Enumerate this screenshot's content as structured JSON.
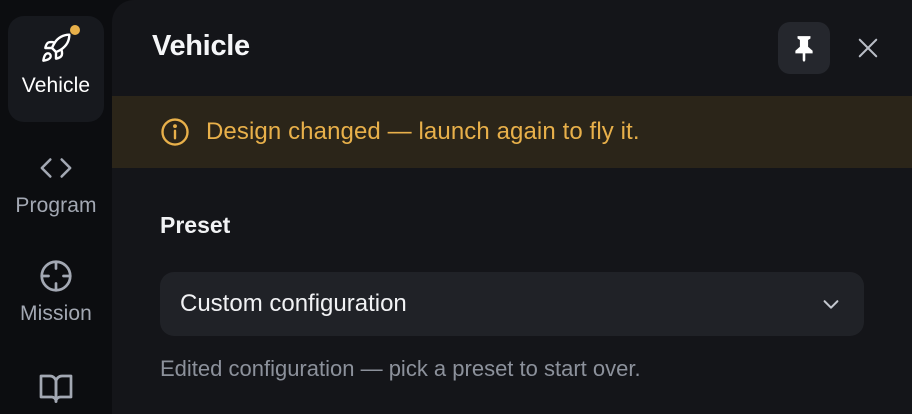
{
  "rail": {
    "items": [
      {
        "label": "Vehicle",
        "icon": "rocket-icon",
        "active": true,
        "badge": true
      },
      {
        "label": "Program",
        "icon": "code-icon",
        "active": false
      },
      {
        "label": "Mission",
        "icon": "crosshair-icon",
        "active": false
      },
      {
        "label": "",
        "icon": "book-icon",
        "active": false
      }
    ]
  },
  "panel": {
    "title": "Vehicle",
    "notice": "Design changed — launch again to fly it.",
    "preset_label": "Preset",
    "preset_value": "Custom configuration",
    "hint": "Edited configuration — pick a preset to start over."
  },
  "colors": {
    "accent_warning": "#e8b04a",
    "panel_bg": "#141519",
    "rail_bg": "#0c0d10",
    "notice_bg": "#2b2519"
  }
}
